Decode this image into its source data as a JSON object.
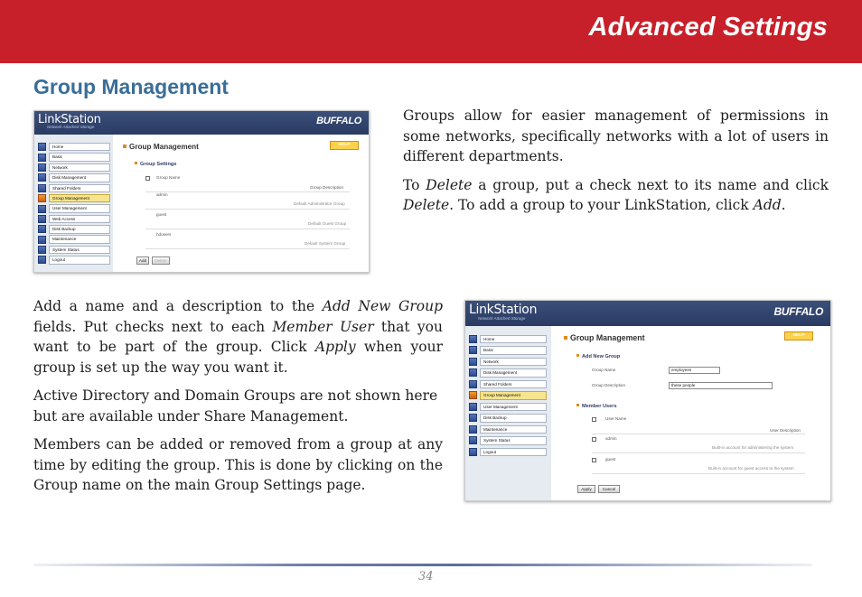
{
  "header": {
    "title": "Advanced Settings"
  },
  "section": {
    "title": "Group Management"
  },
  "intro": {
    "p1": "Groups allow for easier management of permissions in some networks, specifically networks with a lot of users in different departments.",
    "p2_a": "To ",
    "p2_delete_1": "Delete",
    "p2_b": " a group, put a check next to its name and click ",
    "p2_delete_2": "Delete",
    "p2_c": ".  To add a group to your LinkStation, click ",
    "p2_add": "Add",
    "p2_d": "."
  },
  "instructions": {
    "p1_a": "Add a name and a description to the ",
    "p1_addnew": "Add New Group",
    "p1_b": " fields.  Put checks next to each ",
    "p1_member": "Member User",
    "p1_c": " that you want to be part of the group.  Click ",
    "p1_apply": "Apply",
    "p1_d": " when your group is set up the way you want it.",
    "p2": "Active Directory and Domain Groups are not shown here but are available under Share Management.",
    "p3": "Members can be added or removed from a group at any time by editing the group.  This is done by clicking on the Group name on the main Group Settings page."
  },
  "screenshot_common": {
    "logo": "LinkStation",
    "logo_sub": "Network Attached Storage",
    "brand": "BUFFALO",
    "help": "HELP",
    "nav": [
      "Home",
      "Basic",
      "Network",
      "Disk Management",
      "Shared Folders",
      "Group Management",
      "User Management",
      "Web Access",
      "Disk Backup",
      "Maintenance",
      "System Status",
      "Logout"
    ],
    "nav2": [
      "Home",
      "Basic",
      "Network",
      "Disk Management",
      "Shared Folders",
      "Group Management",
      "User Management",
      "Disk Backup",
      "Maintenance",
      "System Status",
      "Logout"
    ],
    "page_title": "Group Management"
  },
  "screenshot1": {
    "subsection": "Group Settings",
    "col_name": "Group Name",
    "col_desc": "Group Description",
    "rows": [
      {
        "name": "admin",
        "desc": "Default Administrator Group"
      },
      {
        "name": "guest",
        "desc": "Default Guest Group"
      },
      {
        "name": "hdusers",
        "desc": "Default System Group"
      }
    ],
    "add_btn": "Add",
    "delete_btn": "Delete"
  },
  "screenshot2": {
    "subsection1": "Add New Group",
    "name_label": "Group Name",
    "name_value": "employees",
    "desc_label": "Group Description",
    "desc_value": "these people",
    "subsection2": "Member Users",
    "col_user": "User Name",
    "col_desc": "User Description",
    "users": [
      {
        "name": "admin",
        "desc": "Built-in account for administering the system"
      },
      {
        "name": "guest",
        "desc": "Built-in account for guest access to the system"
      }
    ],
    "apply_btn": "Apply",
    "cancel_btn": "Cancel"
  },
  "footer": {
    "page_number": "34"
  }
}
